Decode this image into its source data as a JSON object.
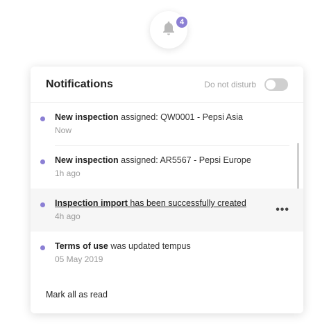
{
  "bell": {
    "icon": "bell-icon",
    "badge_count": "4"
  },
  "panel": {
    "title": "Notifications",
    "dnd_label": "Do not disturb",
    "dnd_enabled": false,
    "items": [
      {
        "strong": "New inspection",
        "rest": " assigned: QW0001 - Pepsi Asia",
        "time": "Now"
      },
      {
        "strong": "New inspection",
        "rest": " assigned: AR5567 - Pepsi Europe",
        "time": "1h ago"
      },
      {
        "strong": "Inspection import",
        "rest": " has been successfully created",
        "time": "4h ago"
      },
      {
        "strong": "Terms of use",
        "rest": " was updated tempus",
        "time": "05 May 2019"
      }
    ],
    "more_label": "•••",
    "footer_label": "Mark all as read"
  },
  "colors": {
    "accent": "#8b7fd4"
  }
}
